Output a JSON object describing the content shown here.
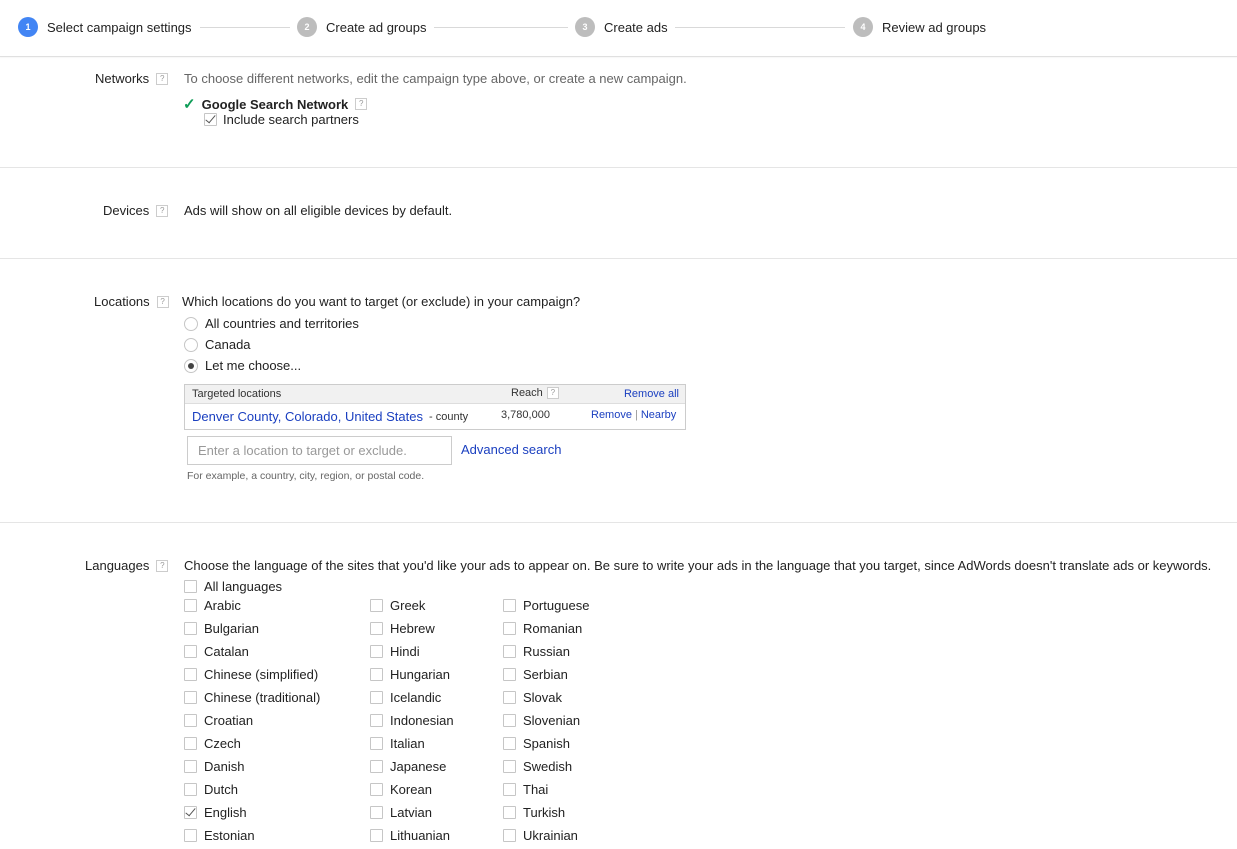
{
  "stepper": {
    "steps": [
      {
        "num": "1",
        "label": "Select campaign settings",
        "active": true
      },
      {
        "num": "2",
        "label": "Create ad groups",
        "active": false
      },
      {
        "num": "3",
        "label": "Create ads",
        "active": false
      },
      {
        "num": "4",
        "label": "Review ad groups",
        "active": false
      }
    ]
  },
  "networks": {
    "label": "Networks",
    "help": "?",
    "description": "To choose different networks, edit the campaign type above, or create a new campaign.",
    "network_name": "Google Search Network",
    "checkmark": "✓",
    "include_partners_label": "Include search partners",
    "include_partners_checked": true
  },
  "devices": {
    "label": "Devices",
    "help": "?",
    "description": "Ads will show on all eligible devices by default."
  },
  "locations": {
    "label": "Locations",
    "help": "?",
    "question": "Which locations do you want to target (or exclude) in your campaign?",
    "options": [
      {
        "label": "All countries and territories",
        "selected": false
      },
      {
        "label": "Canada",
        "selected": false
      },
      {
        "label": "Let me choose...",
        "selected": true
      }
    ],
    "table": {
      "header_location": "Targeted locations",
      "header_reach": "Reach",
      "header_help": "?",
      "remove_all": "Remove all",
      "rows": [
        {
          "name": "Denver County, Colorado, United States",
          "type": "- county",
          "reach": "3,780,000",
          "remove": "Remove",
          "separator": "|",
          "nearby": "Nearby"
        }
      ]
    },
    "search_placeholder": "Enter a location to target or exclude.",
    "search_value": "",
    "advanced_search": "Advanced search",
    "hint": "For example, a country, city, region, or postal code."
  },
  "languages": {
    "label": "Languages",
    "help": "?",
    "description": "Choose the language of the sites that you'd like your ads to appear on. Be sure to write your ads in the language that you target, since AdWords doesn't translate ads or keywords.",
    "all_languages": {
      "label": "All languages",
      "checked": false
    },
    "columns": [
      [
        {
          "label": "Arabic",
          "checked": false
        },
        {
          "label": "Bulgarian",
          "checked": false
        },
        {
          "label": "Catalan",
          "checked": false
        },
        {
          "label": "Chinese (simplified)",
          "checked": false
        },
        {
          "label": "Chinese (traditional)",
          "checked": false
        },
        {
          "label": "Croatian",
          "checked": false
        },
        {
          "label": "Czech",
          "checked": false
        },
        {
          "label": "Danish",
          "checked": false
        },
        {
          "label": "Dutch",
          "checked": false
        },
        {
          "label": "English",
          "checked": true
        },
        {
          "label": "Estonian",
          "checked": false
        }
      ],
      [
        {
          "label": "Greek",
          "checked": false
        },
        {
          "label": "Hebrew",
          "checked": false
        },
        {
          "label": "Hindi",
          "checked": false
        },
        {
          "label": "Hungarian",
          "checked": false
        },
        {
          "label": "Icelandic",
          "checked": false
        },
        {
          "label": "Indonesian",
          "checked": false
        },
        {
          "label": "Italian",
          "checked": false
        },
        {
          "label": "Japanese",
          "checked": false
        },
        {
          "label": "Korean",
          "checked": false
        },
        {
          "label": "Latvian",
          "checked": false
        },
        {
          "label": "Lithuanian",
          "checked": false
        }
      ],
      [
        {
          "label": "Portuguese",
          "checked": false
        },
        {
          "label": "Romanian",
          "checked": false
        },
        {
          "label": "Russian",
          "checked": false
        },
        {
          "label": "Serbian",
          "checked": false
        },
        {
          "label": "Slovak",
          "checked": false
        },
        {
          "label": "Slovenian",
          "checked": false
        },
        {
          "label": "Spanish",
          "checked": false
        },
        {
          "label": "Swedish",
          "checked": false
        },
        {
          "label": "Thai",
          "checked": false
        },
        {
          "label": "Turkish",
          "checked": false
        },
        {
          "label": "Ukrainian",
          "checked": false
        }
      ]
    ]
  },
  "colors": {
    "active_step": "#4285f4",
    "inactive_step": "#bdbdbd",
    "link": "#1a3fc0",
    "checkmark_green": "#0f9d58"
  }
}
